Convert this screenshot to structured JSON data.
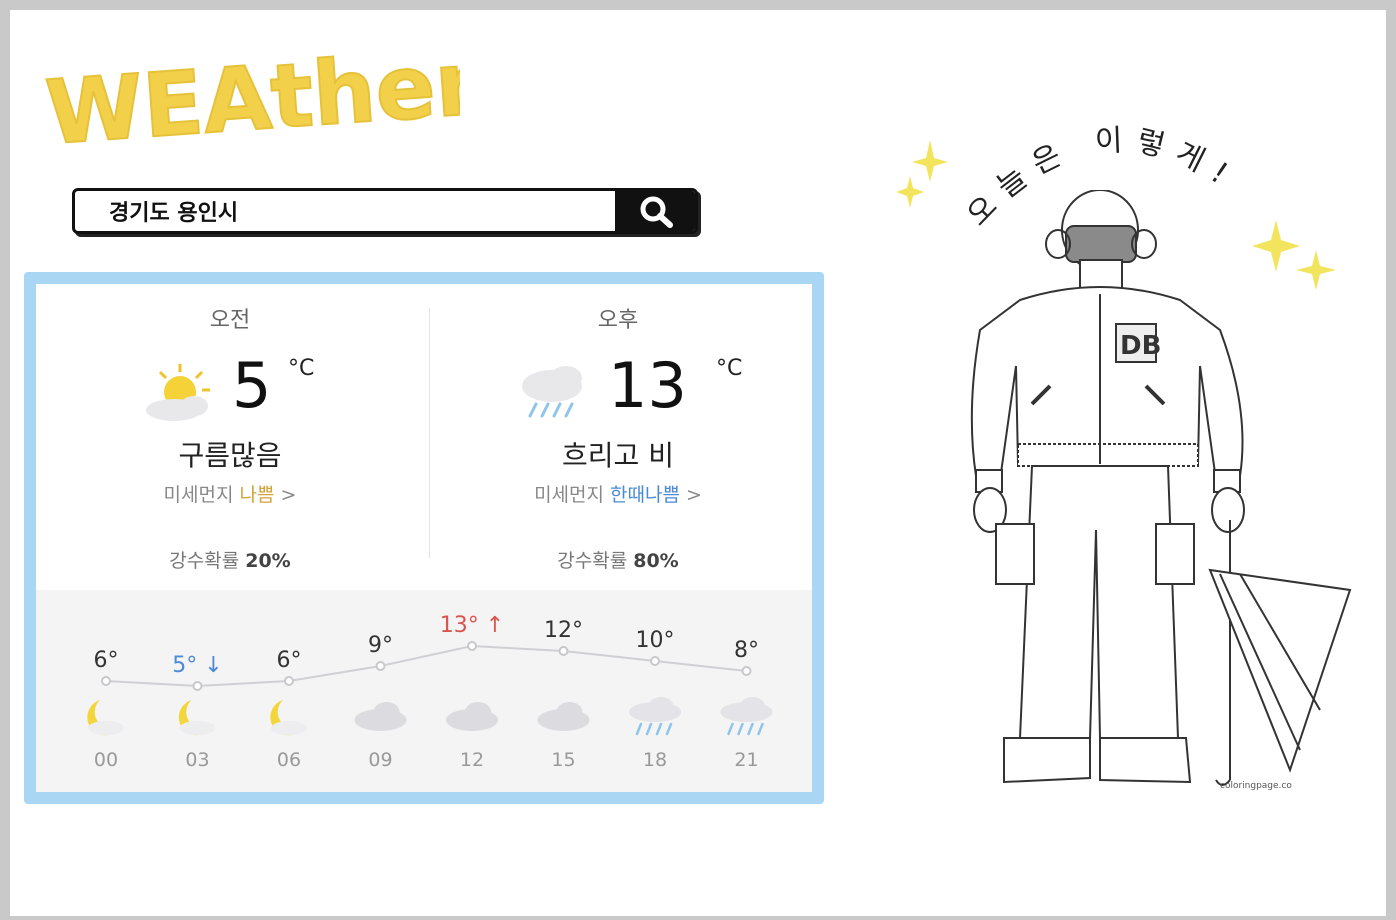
{
  "logo": {
    "text": "WEAther?",
    "icon": "weather-logo"
  },
  "search": {
    "value": "경기도 용인시",
    "button_icon": "search-icon"
  },
  "forecast": {
    "am": {
      "period": "오전",
      "temp": "5",
      "unit": "°C",
      "icon": "sun-cloud-icon",
      "condition": "구름많음",
      "dust_label": "미세먼지",
      "dust_level": "나쁨",
      "dust_arrow": ">",
      "rain_label": "강수확률",
      "rain_value": "20%"
    },
    "pm": {
      "period": "오후",
      "temp": "13",
      "unit": "°C",
      "icon": "rain-cloud-icon",
      "condition": "흐리고 비",
      "dust_label": "미세먼지",
      "dust_level": "한때나쁨",
      "dust_arrow": ">",
      "rain_label": "강수확률",
      "rain_value": "80%"
    }
  },
  "hourly": [
    {
      "time": "00",
      "temp": 6,
      "label": "6°",
      "icon": "moon-cloud-icon"
    },
    {
      "time": "03",
      "temp": 5,
      "label": "5°",
      "mark": "↓",
      "icon": "moon-cloud-icon"
    },
    {
      "time": "06",
      "temp": 6,
      "label": "6°",
      "icon": "moon-cloud-icon"
    },
    {
      "time": "09",
      "temp": 9,
      "label": "9°",
      "icon": "cloud-icon"
    },
    {
      "time": "12",
      "temp": 13,
      "label": "13°",
      "mark": "↑",
      "icon": "cloud-icon"
    },
    {
      "time": "15",
      "temp": 12,
      "label": "12°",
      "icon": "cloud-icon"
    },
    {
      "time": "18",
      "temp": 10,
      "label": "10°",
      "icon": "rain-cloud-icon"
    },
    {
      "time": "21",
      "temp": 8,
      "label": "8°",
      "icon": "rain-cloud-icon"
    }
  ],
  "outfit": {
    "caption": "오늘은 이렇게!",
    "credit": "coloringpage.co"
  },
  "colors": {
    "frame": "#a9d6f2",
    "low": "#4a8ad6",
    "high": "#d9534f",
    "dust_bad": "#d2a33a"
  }
}
